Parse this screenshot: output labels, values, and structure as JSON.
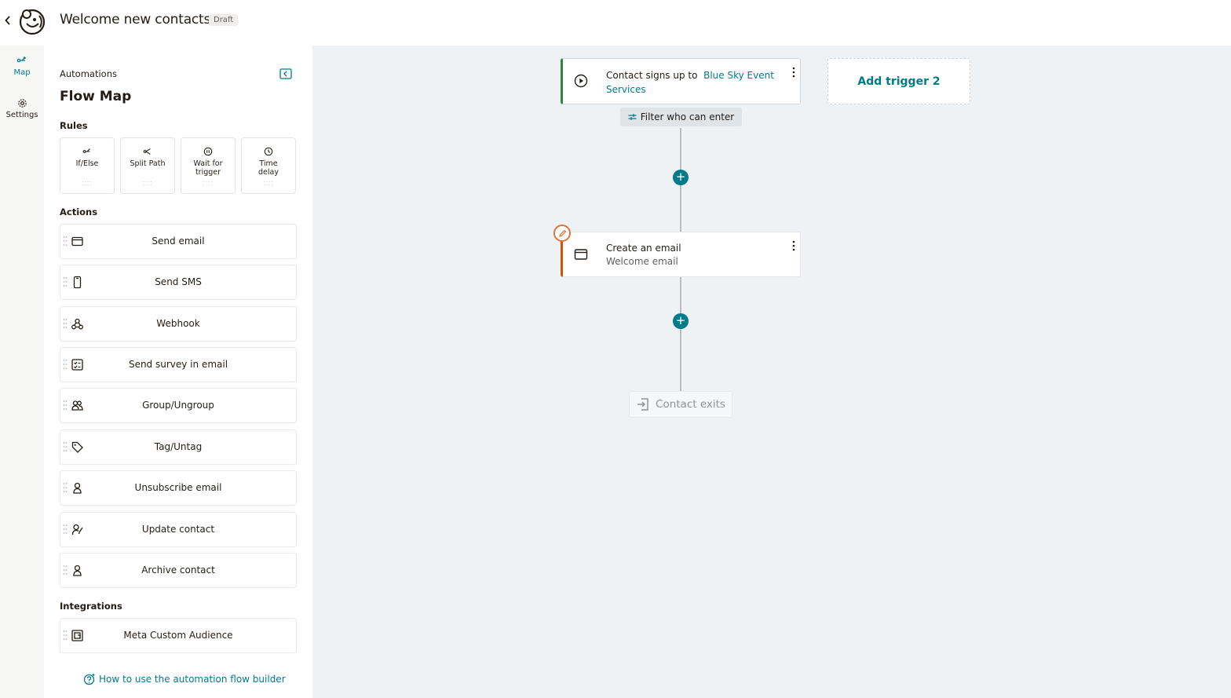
{
  "header": {
    "title": "Welcome new contacts",
    "status_badge": "Draft"
  },
  "rail": {
    "items": [
      {
        "label": "Map",
        "icon": "split-icon",
        "active": true
      },
      {
        "label": "Settings",
        "icon": "gear-icon",
        "active": false
      }
    ]
  },
  "sidebar": {
    "breadcrumb": "Automations",
    "heading": "Flow Map",
    "rules_title": "Rules",
    "rules": [
      {
        "label": "If/Else",
        "icon": "branch-icon"
      },
      {
        "label": "Split Path",
        "icon": "split-path-icon"
      },
      {
        "label": "Wait for trigger",
        "icon": "pause-circle-icon"
      },
      {
        "label": "Time delay",
        "icon": "clock-icon"
      }
    ],
    "actions_title": "Actions",
    "actions": [
      {
        "label": "Send email",
        "icon": "envelope-icon"
      },
      {
        "label": "Send SMS",
        "icon": "phone-icon"
      },
      {
        "label": "Webhook",
        "icon": "webhook-icon"
      },
      {
        "label": "Send survey in email",
        "icon": "survey-icon"
      },
      {
        "label": "Group/Ungroup",
        "icon": "group-icon"
      },
      {
        "label": "Tag/Untag",
        "icon": "tag-icon"
      },
      {
        "label": "Unsubscribe email",
        "icon": "person-icon"
      },
      {
        "label": "Update contact",
        "icon": "person-edit-icon"
      },
      {
        "label": "Archive contact",
        "icon": "person-icon"
      }
    ],
    "integrations_title": "Integrations",
    "integrations": [
      {
        "label": "Meta Custom Audience",
        "icon": "meta-audience-icon"
      }
    ],
    "help_link": "How to use the automation flow builder"
  },
  "canvas": {
    "trigger": {
      "text": "Contact signs up to",
      "link": "Blue Sky Event Services"
    },
    "add_trigger": "Add trigger 2",
    "filter": "Filter who can enter",
    "email_step": {
      "title": "Create an email",
      "subtitle": "Welcome email"
    },
    "exit": "Contact exits"
  },
  "colors": {
    "accent": "#007c89",
    "trigger_border": "#2e8540",
    "email_border": "#d35400",
    "canvas_bg": "#eff2f5"
  }
}
